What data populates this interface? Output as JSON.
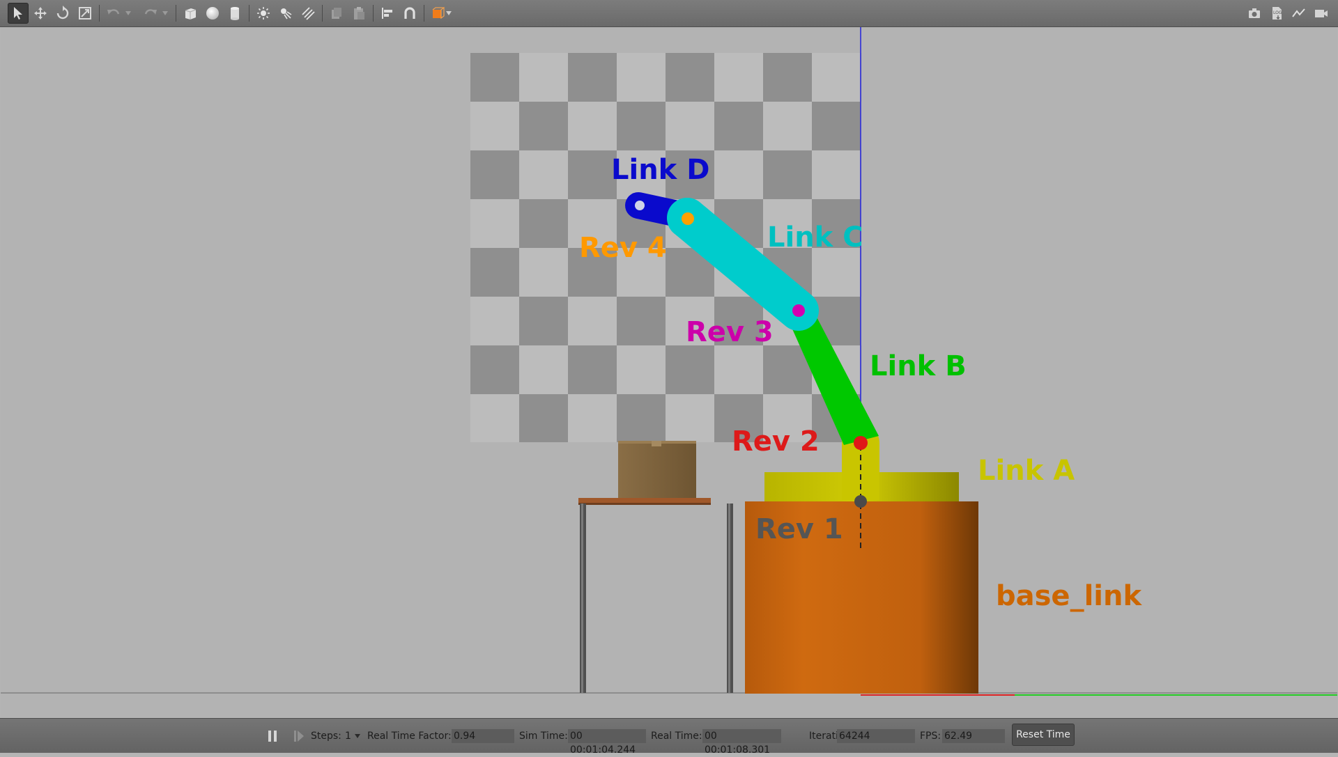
{
  "toolbar": {
    "left_icons": [
      "select-arrow-icon",
      "translate-icon",
      "rotate-icon",
      "scale-icon",
      "undo-icon",
      "redo-icon",
      "box-shape-icon",
      "sphere-shape-icon",
      "cylinder-shape-icon",
      "point-light-icon",
      "spot-light-icon",
      "directional-light-icon",
      "copy-icon",
      "paste-icon",
      "align-icon",
      "snap-magnet-icon",
      "view-angle-icon"
    ],
    "right_icons": [
      "screenshot-camera-icon",
      "log-icon",
      "plot-icon",
      "video-record-icon"
    ]
  },
  "scene": {
    "labels": {
      "link_d": "Link D",
      "link_c": "Link C",
      "link_b": "Link B",
      "link_a": "Link A",
      "base_link": "base_link",
      "rev1": "Rev 1",
      "rev2": "Rev 2",
      "rev3": "Rev 3",
      "rev4": "Rev 4"
    },
    "colors": {
      "link_d": "#0a0acc",
      "link_c": "#00cccc",
      "link_b": "#00c800",
      "link_a": "#cccc00",
      "base_link": "#cc6600",
      "rev1": "#555555",
      "rev2": "#dd1a1a",
      "rev3": "#cc00aa",
      "rev4": "#ff9900"
    }
  },
  "statusbar": {
    "steps_label": "Steps:",
    "steps_value": "1",
    "rtf_label": "Real Time Factor:",
    "rtf_value": "0.94",
    "sim_time_label": "Sim Time:",
    "sim_time_value": "00 00:01:04.244",
    "real_time_label": "Real Time:",
    "real_time_value": "00 00:01:08.301",
    "iterations_label": "Iterations:",
    "iterations_value": "64244",
    "fps_label": "FPS:",
    "fps_value": "62.49",
    "reset_label": "Reset Time"
  }
}
